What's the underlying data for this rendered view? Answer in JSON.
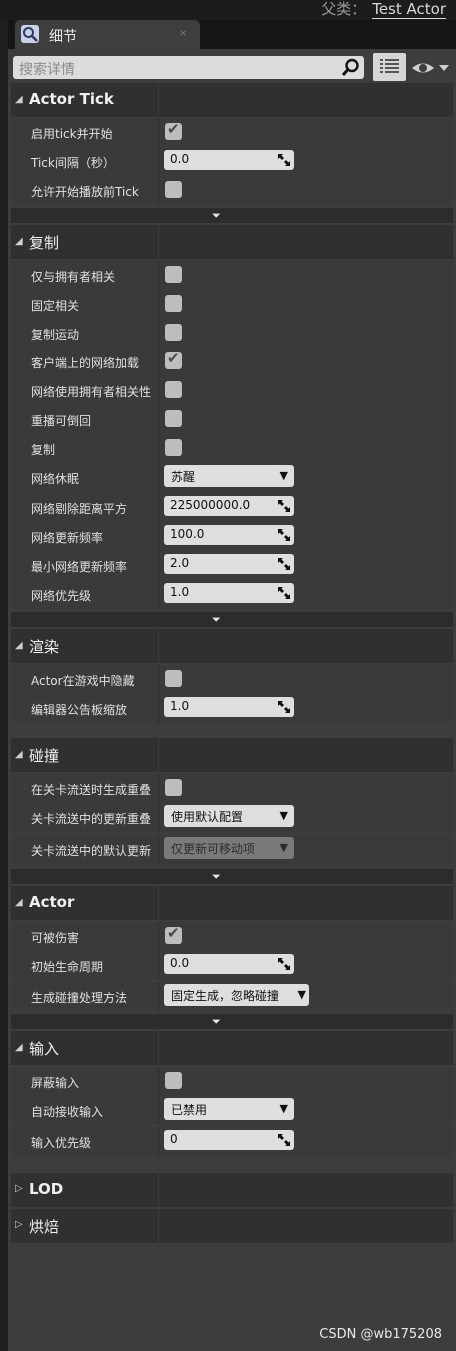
{
  "header": {
    "parent_label": "父类：",
    "parent_value": "Test Actor"
  },
  "tab": {
    "label": "细节",
    "close": "×"
  },
  "search": {
    "placeholder": "搜索详情"
  },
  "sections": {
    "actor_tick": {
      "title": "Actor Tick",
      "props": {
        "start_with_tick": {
          "label": "启用tick并开始",
          "checked": true
        },
        "tick_interval": {
          "label": "Tick间隔（秒）",
          "value": "0.0"
        },
        "allow_tick_before_begin": {
          "label": "允许开始播放前Tick",
          "checked": false
        }
      }
    },
    "replication": {
      "title": "复制",
      "props": {
        "only_relevant_to_owner": {
          "label": "仅与拥有者相关",
          "checked": false
        },
        "always_relevant": {
          "label": "固定相关",
          "checked": false
        },
        "replicate_movement": {
          "label": "复制运动",
          "checked": false
        },
        "net_load_on_client": {
          "label": "客户端上的网络加载",
          "checked": true
        },
        "net_use_owner_relevancy": {
          "label": "网络使用拥有者相关性",
          "checked": false
        },
        "replay_rewindable": {
          "label": "重播可倒回",
          "checked": false
        },
        "replicates": {
          "label": "复制",
          "checked": false
        },
        "net_dormancy": {
          "label": "网络休眠",
          "value": "苏醒"
        },
        "net_cull_distance": {
          "label": "网络剔除距离平方",
          "value": "225000000.0"
        },
        "net_update_freq": {
          "label": "网络更新频率",
          "value": "100.0"
        },
        "min_net_update_freq": {
          "label": "最小网络更新频率",
          "value": "2.0"
        },
        "net_priority": {
          "label": "网络优先级",
          "value": "1.0"
        }
      }
    },
    "rendering": {
      "title": "渲染",
      "props": {
        "hidden_in_game": {
          "label": "Actor在游戏中隐藏",
          "checked": false
        },
        "editor_billboard_scale": {
          "label": "编辑器公告板缩放",
          "value": "1.0"
        }
      }
    },
    "collision": {
      "title": "碰撞",
      "props": {
        "generate_overlap_level_streaming": {
          "label": "在关卡流送时生成重叠",
          "checked": false
        },
        "update_overlaps_method": {
          "label": "关卡流送中的更新重叠",
          "value": "使用默认配置"
        },
        "default_update_overlaps": {
          "label": "关卡流送中的默认更新",
          "value": "仅更新可移动项"
        }
      }
    },
    "actor": {
      "title": "Actor",
      "props": {
        "can_be_damaged": {
          "label": "可被伤害",
          "checked": true
        },
        "initial_life_span": {
          "label": "初始生命周期",
          "value": "0.0"
        },
        "spawn_collision": {
          "label": "生成碰撞处理方法",
          "value": "固定生成，忽略碰撞"
        }
      }
    },
    "input": {
      "title": "输入",
      "props": {
        "block_input": {
          "label": "屏蔽输入",
          "checked": false
        },
        "auto_receive_input": {
          "label": "自动接收输入",
          "value": "已禁用"
        },
        "input_priority": {
          "label": "输入优先级",
          "value": "0"
        }
      }
    },
    "lod": {
      "title": "LOD"
    },
    "cooking": {
      "title": "烘焙"
    }
  },
  "glyphs": {
    "expanded": "◢",
    "collapsed": "▷",
    "dropdown": "▼",
    "advanced": "⏷",
    "check": "✔"
  },
  "icons": {
    "tab": "magnifier-icon",
    "search": "search-icon",
    "view": "list-view-icon",
    "visibility": "eye-icon",
    "stepper": "drag-arrows-icon"
  },
  "watermark": "CSDN @wb175208"
}
